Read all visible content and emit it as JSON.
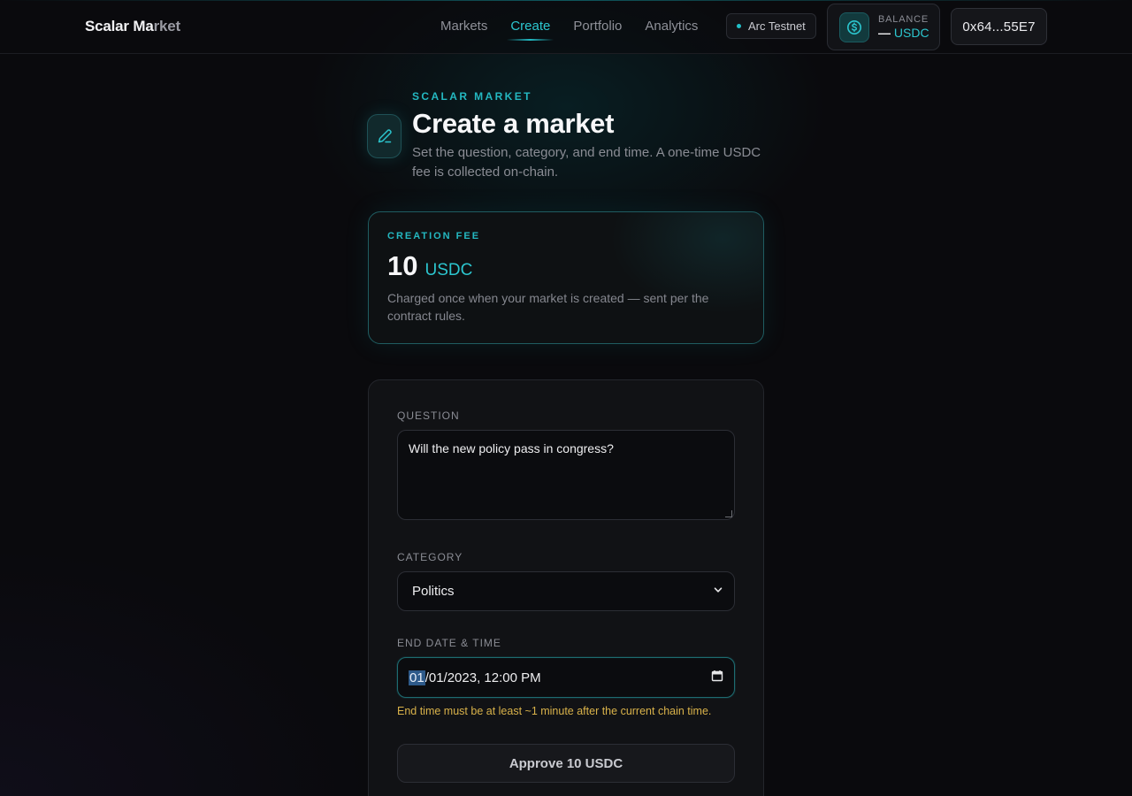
{
  "header": {
    "brand_main": "Scalar Ma",
    "brand_dim": "rket",
    "nav": [
      {
        "label": "Markets"
      },
      {
        "label": "Create"
      },
      {
        "label": "Portfolio"
      },
      {
        "label": "Analytics"
      }
    ],
    "network": "Arc Testnet",
    "balance_label": "BALANCE",
    "balance_value": "—",
    "balance_unit": "USDC",
    "wallet": "0x64...55E7"
  },
  "page": {
    "eyebrow": "SCALAR MARKET",
    "title": "Create a market",
    "subtitle": "Set the question, category, and end time. A one-time USDC fee is collected on-chain."
  },
  "fee": {
    "label": "CREATION FEE",
    "amount": "10",
    "unit": "USDC",
    "description": "Charged once when your market is created — sent per the contract rules."
  },
  "form": {
    "question_label": "QUESTION",
    "question_value": "Will the new policy pass in congress?",
    "category_label": "CATEGORY",
    "category_value": "Politics",
    "end_label": "END DATE & TIME",
    "end_value_month": "01",
    "end_value_rest": "/01/2023, 12:00 PM",
    "end_hint": "End time must be at least ~1 minute after the current chain time.",
    "approve_label": "Approve 10 USDC"
  },
  "colors": {
    "accent": "#2cc6cf",
    "warning": "#d9b24a",
    "background": "#0a0a0d"
  }
}
